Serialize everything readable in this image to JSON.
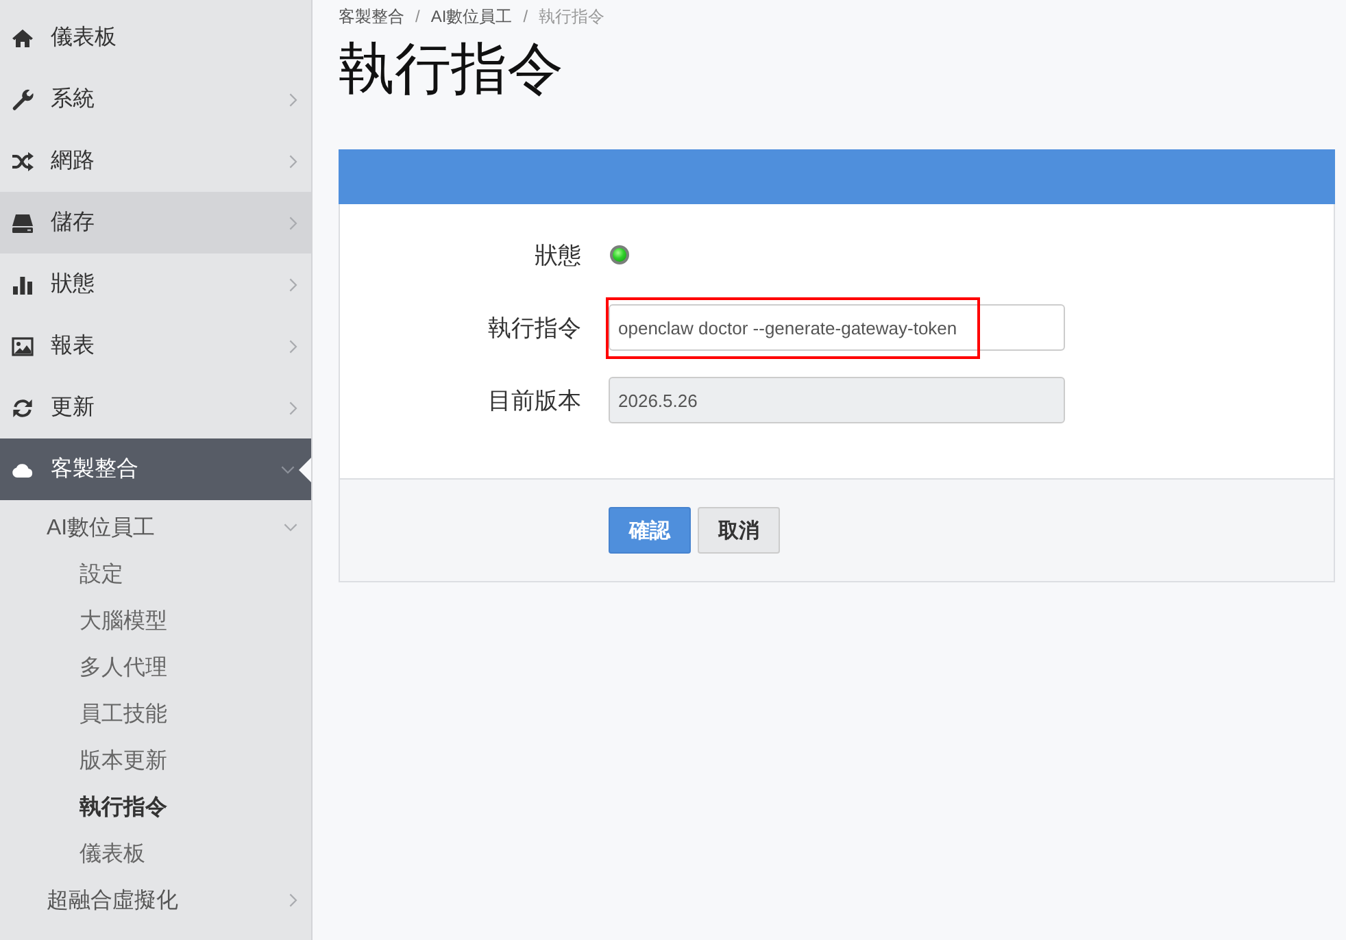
{
  "sidebar": {
    "items": [
      {
        "label": "儀表板",
        "kind": "link",
        "selected": false,
        "hovered": false,
        "expanded": false
      },
      {
        "label": "系統",
        "kind": "group",
        "selected": false,
        "hovered": false,
        "expanded": false
      },
      {
        "label": "網路",
        "kind": "group",
        "selected": false,
        "hovered": false,
        "expanded": false
      },
      {
        "label": "儲存",
        "kind": "group",
        "selected": false,
        "hovered": true,
        "expanded": false
      },
      {
        "label": "狀態",
        "kind": "group",
        "selected": false,
        "hovered": false,
        "expanded": false
      },
      {
        "label": "報表",
        "kind": "group",
        "selected": false,
        "hovered": false,
        "expanded": false
      },
      {
        "label": "更新",
        "kind": "group",
        "selected": false,
        "hovered": false,
        "expanded": false
      },
      {
        "label": "客製整合",
        "kind": "group",
        "selected": true,
        "hovered": false,
        "expanded": true,
        "children": [
          {
            "label": "AI數位員工",
            "kind": "group",
            "selected": false,
            "expanded": true,
            "children": [
              {
                "label": "設定",
                "selected": false
              },
              {
                "label": "大腦模型",
                "selected": false
              },
              {
                "label": "多人代理",
                "selected": false
              },
              {
                "label": "員工技能",
                "selected": false
              },
              {
                "label": "版本更新",
                "selected": false
              },
              {
                "label": "執行指令",
                "selected": true
              },
              {
                "label": "儀表板",
                "selected": false
              }
            ]
          },
          {
            "label": "超融合虛擬化",
            "kind": "group",
            "selected": false,
            "expanded": false
          }
        ]
      }
    ]
  },
  "breadcrumb": [
    {
      "label": "客製整合",
      "current": false,
      "separator": "/"
    },
    {
      "label": "AI數位員工",
      "current": false,
      "separator": "/"
    },
    {
      "label": "執行指令",
      "current": true
    }
  ],
  "page_title": "執行指令",
  "form": {
    "fields": [
      {
        "kind": "status",
        "label": "狀態",
        "on": true
      },
      {
        "kind": "text",
        "label": "執行指令",
        "value": "openclaw doctor --generate-gateway-token",
        "disabled": false,
        "highlighted": true
      },
      {
        "kind": "text",
        "label": "目前版本",
        "value": "2026.5.26",
        "disabled": true,
        "highlighted": false
      }
    ],
    "buttons": [
      {
        "label": "確認",
        "kind": "primary"
      },
      {
        "label": "取消",
        "kind": "default"
      }
    ]
  }
}
